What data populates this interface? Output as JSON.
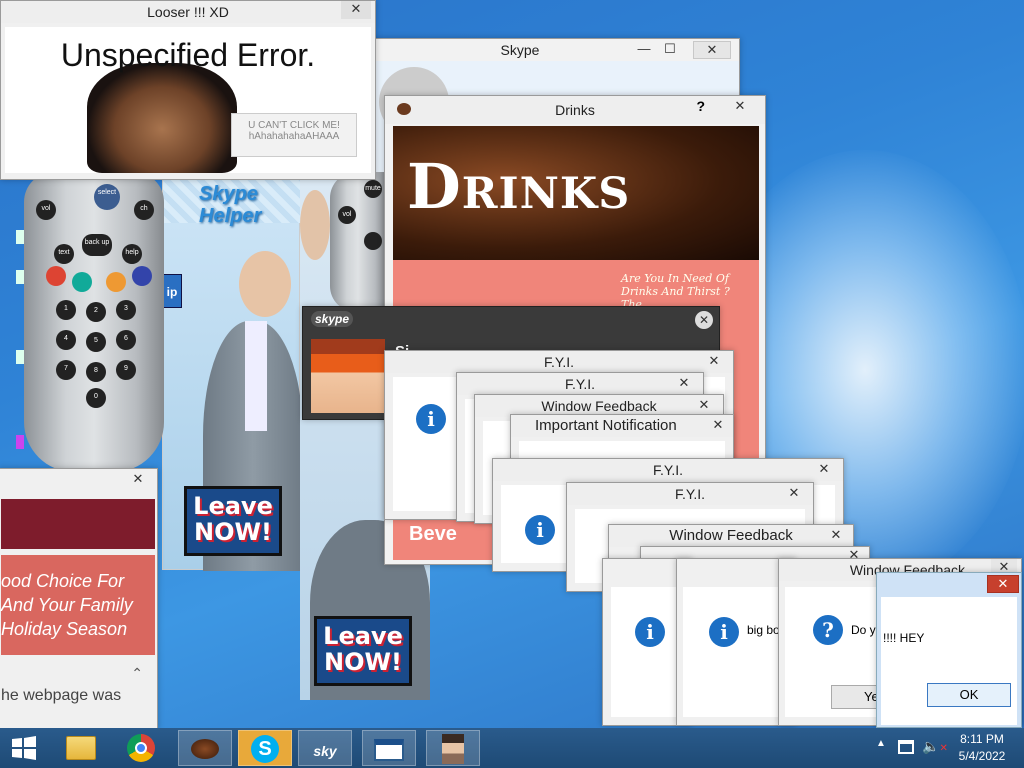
{
  "error_window": {
    "title": "Looser !!! XD",
    "heading": "Unspecified Error.",
    "button_label": "U CAN'T CLICK ME!\nhAhahahahaAHAAA"
  },
  "skype_window": {
    "title": "Skype",
    "logo_text": "skype",
    "banner_text": "Skype Helper",
    "side_text": "ip"
  },
  "drinks_window": {
    "title": "Drinks",
    "help": "?",
    "banner": "Drinks",
    "tagline": "Are You In Need Of\nDrinks And Thirst ?\nThe\nWorld!",
    "footer_text": "Beve"
  },
  "skype_call": {
    "logo_text": "skype",
    "partial_name": "Si"
  },
  "ad_window": {
    "promo_text": "ood Choice For\nAnd Your Family\nHoliday Season",
    "status_text": "he webpage was"
  },
  "leave_buttons": [
    "Leave\nNOW!",
    "Leave\nNOW!"
  ],
  "dialogs": {
    "fyi_1": "F.Y.I.",
    "fyi_2": "F.Y.I.",
    "feedback_1": "Window Feedback",
    "important": "Important Notification",
    "fyi_3": "F.Y.I.",
    "fyi_4": "F.Y.I.",
    "feedback_2": "Window Feedback",
    "feedback_3": "Window Feedback",
    "msg_big": "big bo",
    "msg_do": "Do y",
    "yes_partial": "Ye"
  },
  "hey_dialog": {
    "message": "!!!! HEY",
    "ok": "OK"
  },
  "taskbar": {
    "time": "8:11 PM",
    "date": "5/4/2022",
    "skype_label": "sky"
  },
  "colors": {
    "accent": "#1c6fc4",
    "close_red": "#c7402d",
    "taskbar": "#1e4a75",
    "drinks_pink": "#f0857a"
  }
}
